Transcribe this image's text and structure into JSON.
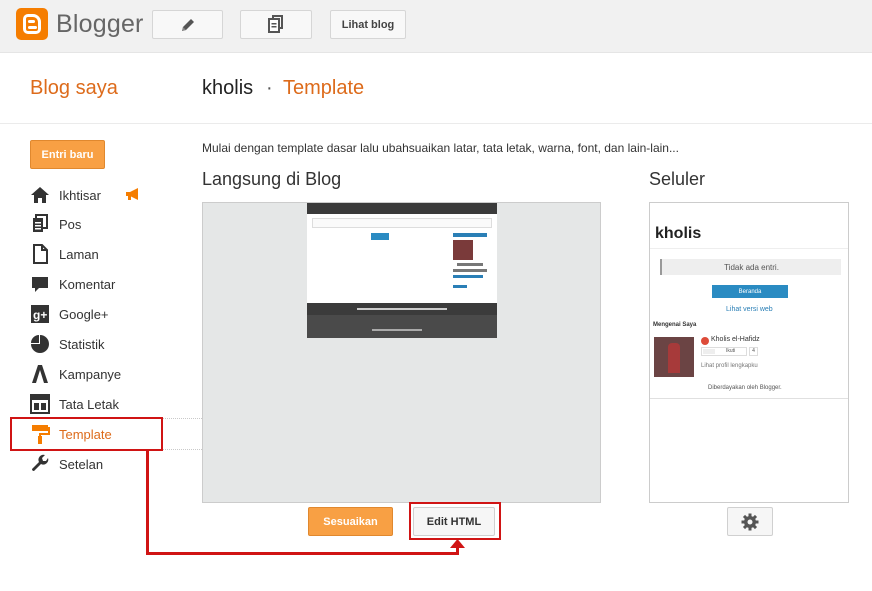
{
  "topbar": {
    "brand": "Blogger",
    "icons": [
      "pencil-icon",
      "pages-icon"
    ],
    "view_blog_label": "Lihat blog"
  },
  "header": {
    "section": "Blog saya",
    "blog_name": "kholis",
    "separator": "·",
    "page": "Template"
  },
  "sidebar": {
    "new_post_label": "Entri baru",
    "items": [
      {
        "label": "Ikhtisar",
        "icon": "home-icon"
      },
      {
        "label": "Pos",
        "icon": "posts-icon"
      },
      {
        "label": "Laman",
        "icon": "page-icon"
      },
      {
        "label": "Komentar",
        "icon": "comment-icon"
      },
      {
        "label": "Google+",
        "icon": "google-plus-icon"
      },
      {
        "label": "Statistik",
        "icon": "pie-chart-icon"
      },
      {
        "label": "Kampanye",
        "icon": "campaign-icon"
      },
      {
        "label": "Tata Letak",
        "icon": "layout-icon"
      },
      {
        "label": "Template",
        "icon": "paint-roller-icon",
        "selected": true
      },
      {
        "label": "Setelan",
        "icon": "wrench-icon"
      }
    ],
    "accent": "#dd6b1b"
  },
  "main": {
    "description": "Mulai dengan template dasar lalu ubahsuaikan latar, tata letak, warna, font, dan lain-lain...",
    "live_title": "Langsung di Blog",
    "mobile_title": "Seluler",
    "customize_label": "Sesuaikan",
    "edit_html_label": "Edit HTML"
  },
  "mobile_preview": {
    "blog_title": "kholis",
    "no_posts": "Tidak ada entri.",
    "home_button": "Beranda",
    "web_version": "Lihat versi web",
    "about_title": "Mengenai Saya",
    "profile_name": "Kholis el-Hafidz",
    "gplus_label": "Ikuti",
    "gplus_count": "4",
    "view_profile": "Lihat profil lengkapku",
    "powered_by": "Diberdayakan oleh Blogger."
  },
  "colors": {
    "orange_button": "#f8a044",
    "annotation": "#d01414",
    "link_blue": "#2a7fb6"
  }
}
